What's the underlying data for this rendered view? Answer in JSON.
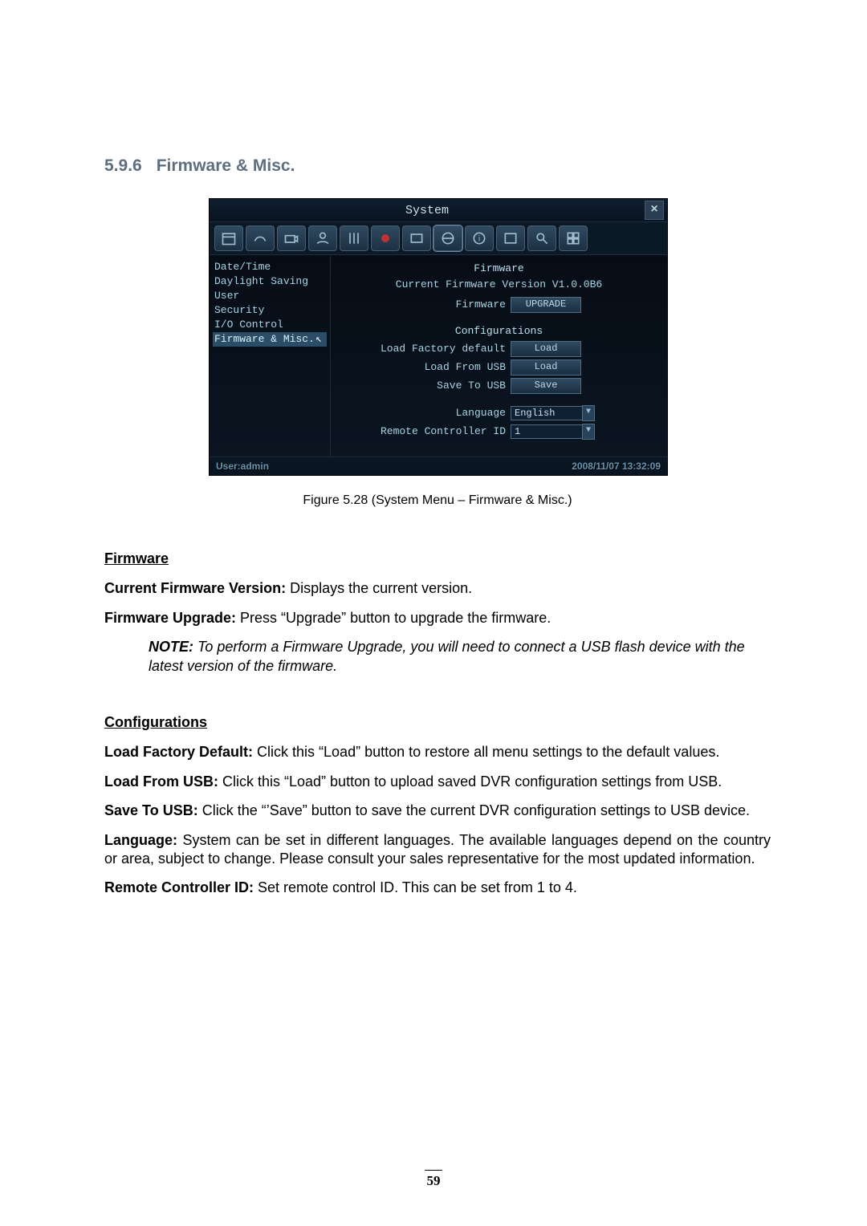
{
  "section": {
    "number": "5.9.6",
    "title": "Firmware & Misc."
  },
  "dvr": {
    "window_title": "System",
    "close_glyph": "×",
    "toolbar_icons": [
      "calendar-icon",
      "paint-icon",
      "camera-icon",
      "user-icon",
      "sliders-icon",
      "record-icon",
      "alarm-icon",
      "network-icon",
      "info-icon",
      "schedule-icon",
      "search-icon",
      "grid-icon"
    ],
    "nav": [
      "Date/Time",
      "Daylight Saving",
      "User",
      "Security",
      "I/O Control",
      "Firmware & Misc."
    ],
    "nav_selected_index": 5,
    "firmware_group": "Firmware",
    "current_version_line": "Current Firmware Version V1.0.0B6",
    "firmware_label": "Firmware",
    "upgrade_btn": "UPGRADE",
    "config_group": "Configurations",
    "rows": {
      "load_factory_label": "Load Factory default",
      "load_factory_btn": "Load",
      "load_usb_label": "Load From USB",
      "load_usb_btn": "Load",
      "save_usb_label": "Save To USB",
      "save_usb_btn": "Save",
      "language_label": "Language",
      "language_value": "English",
      "remote_id_label": "Remote Controller ID",
      "remote_id_value": "1"
    },
    "status_user": "User:admin",
    "status_time": "2008/11/07  13:32:09"
  },
  "caption": "Figure 5.28 (System Menu – Firmware & Misc.)",
  "copy": {
    "firmware_h": "Firmware",
    "cfv_lead": "Current Firmware Version:",
    "cfv_rest": " Displays the current version.",
    "fu_lead": "Firmware Upgrade:",
    "fu_rest": " Press “Upgrade” button to upgrade the firmware.",
    "note_lead": "NOTE:",
    "note_rest": " To perform a Firmware Upgrade, you will need to connect a USB flash device with the latest version of the firmware.",
    "config_h": "Configurations",
    "lfd_lead": "Load Factory Default:",
    "lfd_rest": " Click this “Load” button to restore all menu settings to the default values.",
    "lfu_lead": "Load From USB:",
    "lfu_rest": " Click this “Load” button to upload saved DVR configuration settings from USB.",
    "stu_lead": "Save To USB:",
    "stu_rest": " Click the “’Save” button to save the current DVR configuration settings to USB device.",
    "lang_lead": "Language:",
    "lang_rest": " System can be set in different languages. The available languages depend on the country or area, subject to change. Please consult your sales representative for the most updated information.",
    "rcid_lead": "Remote Controller ID:",
    "rcid_rest": " Set remote control ID. This can be set from 1 to 4."
  },
  "page_number": "59"
}
